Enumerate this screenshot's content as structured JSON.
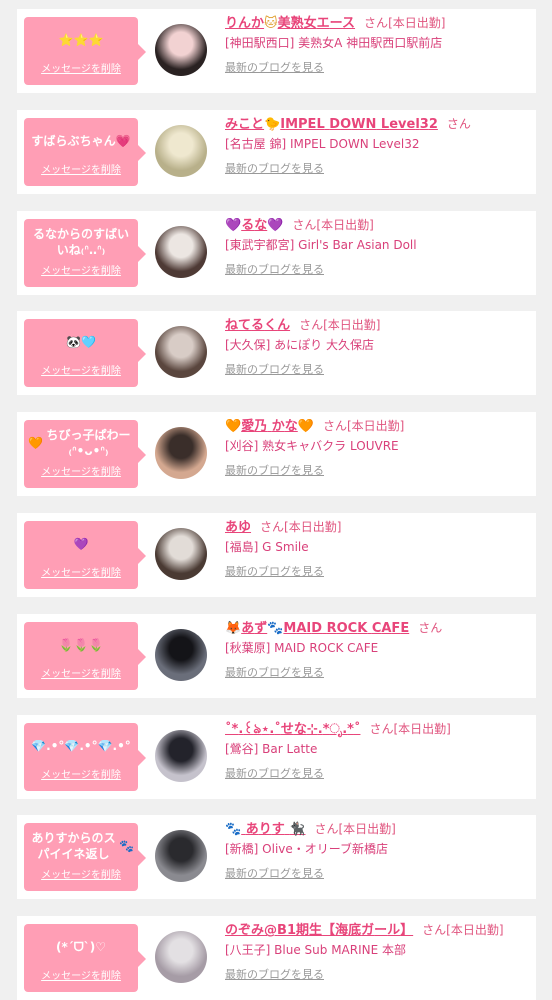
{
  "ui": {
    "delete_label": "メッセージを削除",
    "blog_label": "最新のブログを見る",
    "honorific": "さん"
  },
  "colors": {
    "tag_bg": "#ff9eb5",
    "name": "#e8457a",
    "shop": "#d9407a",
    "blog": "#999999",
    "page_bg": "#f0f0f0"
  },
  "items": [
    {
      "message": "⭐⭐⭐",
      "name": "りんか🐱美熟女エース",
      "status": "[本日出勤]",
      "shop": "[神田駅西口] 美熟女A 神田駅西口駅前店",
      "avatar_colors": [
        "#f2d2d2",
        "#2a2222"
      ]
    },
    {
      "message": "すばらぶちゃん💗",
      "name": "みこと🐤IMPEL DOWN Level32",
      "status": "",
      "shop": "[名古屋 錦] IMPEL DOWN Level32",
      "avatar_colors": [
        "#efe8cf",
        "#b8b08a"
      ]
    },
    {
      "message": "るなからのすばいいね₍ᐢ‥ᐢ₎",
      "name": "💜るな💜",
      "status": "[本日出勤]",
      "shop": "[東武宇都宮] Girl's Bar Asian Doll",
      "avatar_colors": [
        "#ece6e2",
        "#4e3a35"
      ]
    },
    {
      "message": "🐼🩵",
      "name": "ねてるくん",
      "status": "[本日出勤]",
      "shop": "[大久保] あにぽり 大久保店",
      "avatar_colors": [
        "#d8ccc6",
        "#5a463e"
      ]
    },
    {
      "message": "🧡ちびっ子ぱわー₍ᐢ•ᴗ•ᐢ₎",
      "name": "🧡愛乃 かな🧡",
      "status": "[本日出勤]",
      "shop": "[刈谷] 熟女キャバクラ LOUVRE",
      "avatar_colors": [
        "#3a2e2a",
        "#d4a890"
      ]
    },
    {
      "message": "💜",
      "name": "あゆ",
      "status": "[本日出勤]",
      "shop": "[福島] G Smile",
      "avatar_colors": [
        "#e2dcd7",
        "#4a3a33"
      ]
    },
    {
      "message": "🌷🌷🌷",
      "name": "🦊あず🐾MAID ROCK CAFE",
      "status": "",
      "shop": "[秋葉原] MAID ROCK CAFE",
      "avatar_colors": [
        "#141418",
        "#6a6e7a"
      ]
    },
    {
      "message": "💎.•°💎.•°💎.•°",
      "name": "˚*.꒰ঌ⋆.˚せな⊹.*ೃ.*˚",
      "status": "[本日出勤]",
      "shop": "[鶯谷] Bar Latte",
      "avatar_colors": [
        "#23232b",
        "#c5c2cc"
      ]
    },
    {
      "message": "ありすからのスパイイネ返し🐾",
      "name": "🐾 ありす 🐈‍⬛",
      "status": "[本日出勤]",
      "shop": "[新橋] Olive・オリーブ新橋店",
      "avatar_colors": [
        "#2a2a2e",
        "#8a8a90"
      ]
    },
    {
      "message": "(*ˊᗜˋ)♡",
      "name": "のぞみ@B1期生【海底ガール】",
      "status": "[本日出勤]",
      "shop": "[八王子] Blue Sub MARINE 本部",
      "avatar_colors": [
        "#e3e0e3",
        "#a69ca6"
      ]
    }
  ]
}
